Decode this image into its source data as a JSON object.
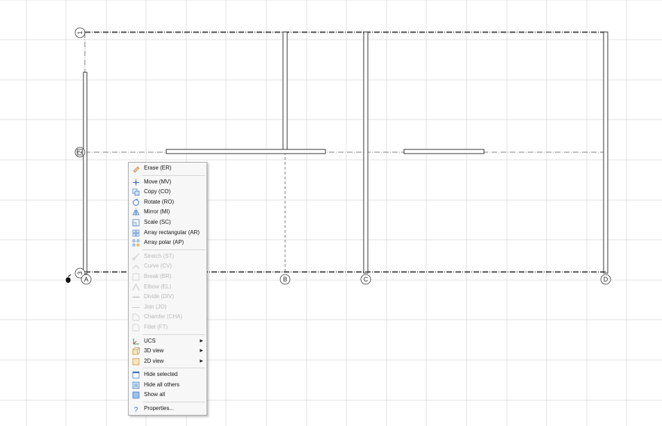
{
  "axes": {
    "horizontal": [
      {
        "label": "1"
      },
      {
        "label": "2"
      },
      {
        "label": "3"
      }
    ],
    "vertical": [
      {
        "label": "A"
      },
      {
        "label": "B"
      },
      {
        "label": "C"
      },
      {
        "label": "D"
      }
    ]
  },
  "context_menu": {
    "groups": [
      [
        {
          "label": "Erase (ER)",
          "icon": "eraser-icon",
          "enabled": true
        }
      ],
      [
        {
          "label": "Move (MV)",
          "icon": "move-icon",
          "enabled": true
        },
        {
          "label": "Copy (CO)",
          "icon": "copy-icon",
          "enabled": true
        },
        {
          "label": "Rotate (RO)",
          "icon": "rotate-icon",
          "enabled": true
        },
        {
          "label": "Mirror (MI)",
          "icon": "mirror-icon",
          "enabled": true
        },
        {
          "label": "Scale (SC)",
          "icon": "scale-icon",
          "enabled": true
        },
        {
          "label": "Array rectangular (AR)",
          "icon": "array-rectangular-icon",
          "enabled": true
        },
        {
          "label": "Array polar (AP)",
          "icon": "array-polar-icon",
          "enabled": true
        }
      ],
      [
        {
          "label": "Stretch (ST)",
          "icon": "stretch-icon",
          "enabled": false
        },
        {
          "label": "Curve (CV)",
          "icon": "curve-icon",
          "enabled": false
        },
        {
          "label": "Break (BR)",
          "icon": "break-icon",
          "enabled": false
        },
        {
          "label": "Elbow (EL)",
          "icon": "elbow-icon",
          "enabled": false
        },
        {
          "label": "Divide (DIV)",
          "icon": "divide-icon",
          "enabled": false
        },
        {
          "label": "Join (JO)",
          "icon": "join-icon",
          "enabled": false
        },
        {
          "label": "Chamfer (CHA)",
          "icon": "chamfer-icon",
          "enabled": false
        },
        {
          "label": "Fillet (FT)",
          "icon": "fillet-icon",
          "enabled": false
        }
      ],
      [
        {
          "label": "UCS",
          "icon": "ucs-icon",
          "enabled": true,
          "submenu": true
        },
        {
          "label": "3D view",
          "icon": "3d-view-icon",
          "enabled": true,
          "submenu": true
        },
        {
          "label": "2D view",
          "icon": "2d-view-icon",
          "enabled": true,
          "submenu": true
        }
      ],
      [
        {
          "label": "Hide selected",
          "icon": "hide-selected-icon",
          "enabled": true
        },
        {
          "label": "Hide all others",
          "icon": "hide-others-icon",
          "enabled": true
        },
        {
          "label": "Show all",
          "icon": "show-all-icon",
          "enabled": true
        }
      ],
      [
        {
          "label": "Properties...",
          "icon": "help-icon",
          "enabled": true
        }
      ]
    ]
  },
  "colors": {
    "grid": "#d9d9d9",
    "wall": "#1a1a1a",
    "axis_line": "#555555",
    "menu_bg": "#f7f7f7",
    "disabled_text": "#b8b8b8"
  }
}
